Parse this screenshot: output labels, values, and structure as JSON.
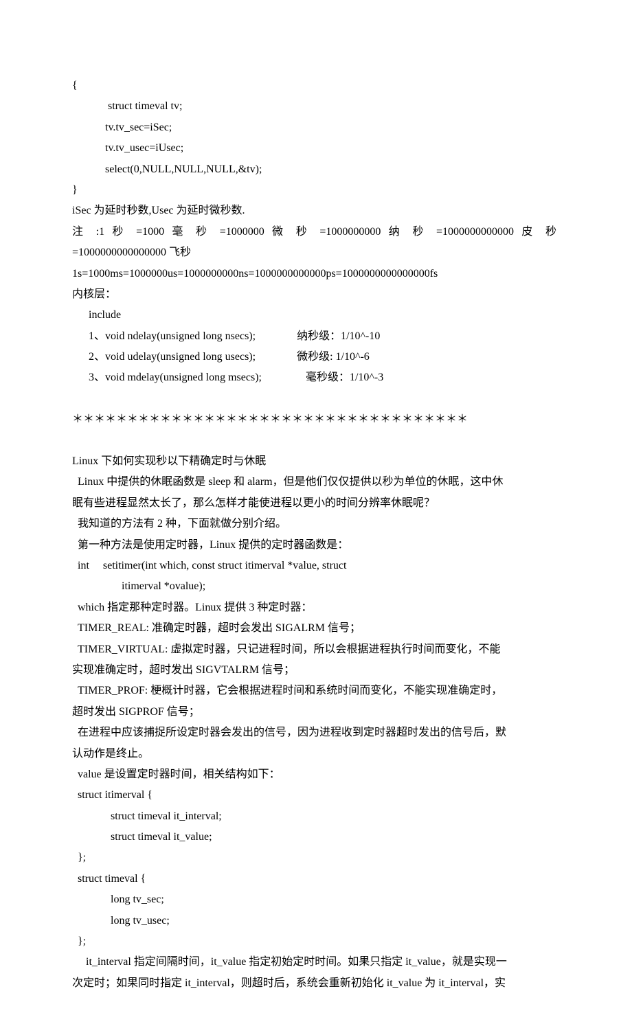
{
  "lines": [
    {
      "t": "{",
      "j": false
    },
    {
      "t": "             struct timeval tv;",
      "j": false
    },
    {
      "t": "            tv.tv_sec=iSec;",
      "j": false
    },
    {
      "t": "            tv.tv_usec=iUsec;",
      "j": false
    },
    {
      "t": "            select(0,NULL,NULL,NULL,&tv);",
      "j": false
    },
    {
      "t": "}",
      "j": false
    },
    {
      "t": "iSec 为延时秒数,Usec 为延时微秒数.",
      "j": false
    },
    {
      "t": "注 :1 秒 =1000 毫 秒 =1000000 微 秒 =1000000000 纳 秒 =1000000000000 皮 秒",
      "j": true
    },
    {
      "t": "=1000000000000000 飞秒",
      "j": false
    },
    {
      "t": "1s=1000ms=1000000us=1000000000ns=1000000000000ps=1000000000000000fs",
      "j": false
    },
    {
      "t": "内核层：",
      "j": false
    },
    {
      "t": "      include",
      "j": false
    },
    {
      "t": "      1、void ndelay(unsigned long nsecs);               纳秒级：1/10^-10",
      "j": false
    },
    {
      "t": "      2、void udelay(unsigned long usecs);               微秒级: 1/10^-6",
      "j": false
    },
    {
      "t": "      3、void mdelay(unsigned long msecs);                毫秒级：1/10^-3",
      "j": false
    },
    {
      "t": "",
      "j": false
    },
    {
      "t": "＊＊＊＊＊＊＊＊＊＊＊＊＊＊＊＊＊＊＊＊＊＊＊＊＊＊＊＊＊＊＊＊＊＊＊＊",
      "j": false
    },
    {
      "t": "",
      "j": false
    },
    {
      "t": "Linux 下如何实现秒以下精确定时与休眠",
      "j": false
    },
    {
      "t": "  Linux 中提供的休眠函数是 sleep 和 alarm，但是他们仅仅提供以秒为单位的休眠，这中休",
      "j": false
    },
    {
      "t": "眠有些进程显然太长了，那么怎样才能使进程以更小的时间分辨率休眠呢？",
      "j": false
    },
    {
      "t": "  我知道的方法有 2 种，下面就做分别介绍。",
      "j": false
    },
    {
      "t": "  第一种方法是使用定时器，Linux 提供的定时器函数是：",
      "j": false
    },
    {
      "t": "  int     setitimer(int which, const struct itimerval *value, struct",
      "j": false
    },
    {
      "t": "                  itimerval *ovalue);",
      "j": false
    },
    {
      "t": "  which 指定那种定时器。Linux 提供 3 种定时器：",
      "j": false
    },
    {
      "t": "  TIMER_REAL: 准确定时器，超时会发出 SIGALRM 信号；",
      "j": false
    },
    {
      "t": "  TIMER_VIRTUAL: 虚拟定时器，只记进程时间，所以会根据进程执行时间而变化，不能",
      "j": false
    },
    {
      "t": "实现准确定时，超时发出 SIGVTALRM 信号；",
      "j": false
    },
    {
      "t": "  TIMER_PROF: 梗概计时器，它会根据进程时间和系统时间而变化，不能实现准确定时，",
      "j": false
    },
    {
      "t": "超时发出 SIGPROF 信号；",
      "j": false
    },
    {
      "t": "  在进程中应该捕捉所设定时器会发出的信号，因为进程收到定时器超时发出的信号后，默",
      "j": false
    },
    {
      "t": "认动作是终止。",
      "j": false
    },
    {
      "t": "  value 是设置定时器时间，相关结构如下：",
      "j": false
    },
    {
      "t": "  struct itimerval {",
      "j": false
    },
    {
      "t": "              struct timeval it_interval;",
      "j": false
    },
    {
      "t": "              struct timeval it_value;",
      "j": false
    },
    {
      "t": "  };",
      "j": false
    },
    {
      "t": "  struct timeval {",
      "j": false
    },
    {
      "t": "              long tv_sec;",
      "j": false
    },
    {
      "t": "              long tv_usec;",
      "j": false
    },
    {
      "t": "  };",
      "j": false
    },
    {
      "t": "     it_interval 指定间隔时间，it_value 指定初始定时时间。如果只指定 it_value，就是实现一",
      "j": false
    },
    {
      "t": "次定时；如果同时指定 it_interval，则超时后，系统会重新初始化 it_value 为 it_interval，实",
      "j": false
    }
  ]
}
